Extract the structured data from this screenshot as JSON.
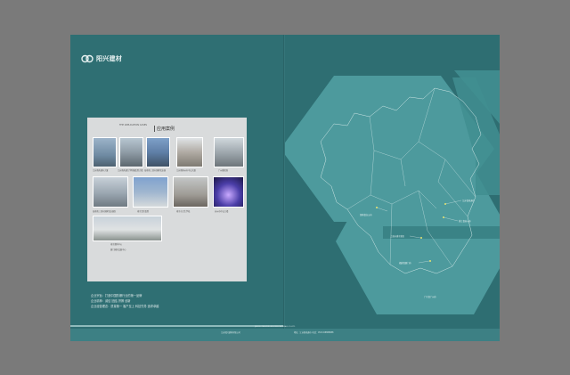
{
  "brand": {
    "name": "阳兴建材"
  },
  "panel": {
    "header_small": "THE APPLICATION CASES",
    "title": "应用案例"
  },
  "photos": [
    {
      "caption": "江苏省南通市大厦"
    },
    {
      "caption": "江苏省南通大学附属医院大楼"
    },
    {
      "caption": "海南省三亚市国家农业园"
    },
    {
      "caption": "江苏省扬州市中山大厦"
    },
    {
      "caption": "广州番禺塔"
    },
    {
      "caption": "海南省三亚市国家农业园区"
    },
    {
      "caption": "南京军区医院"
    },
    {
      "caption": "南京市卫生学校"
    },
    {
      "caption": "苏州市中山大楼"
    },
    {
      "caption": "南京奥体中心"
    },
    {
      "caption": "厦门国际会展中心"
    }
  ],
  "intro": [
    "企业宗旨：打造中国防爆行业的第一品牌",
    "企业精神：诚信  团结  拼搏  创新",
    "企业经营理念：质量第一 客户至上 科技先导 追求卓越"
  ],
  "footer": {
    "center_small": "JIANGSU YANGXING BUILDING MATERIALS CO.,LTD.",
    "left": "江苏阳兴建材有限公司",
    "right": "地址：江苏省南通市  电话：0513-88888888"
  },
  "callouts": [
    {
      "text": "江苏省南通市"
    },
    {
      "text": "浙江省杭州市"
    },
    {
      "text": "湖南省长沙市"
    },
    {
      "text": "上海市浦东新区"
    },
    {
      "text": "福建省厦门市"
    },
    {
      "text": "广东省广州市"
    }
  ],
  "colors": {
    "page": "#2f6f73",
    "accent": "#5aa9ab",
    "panel": "#d9dbdc",
    "pin": "#e9e36f"
  }
}
